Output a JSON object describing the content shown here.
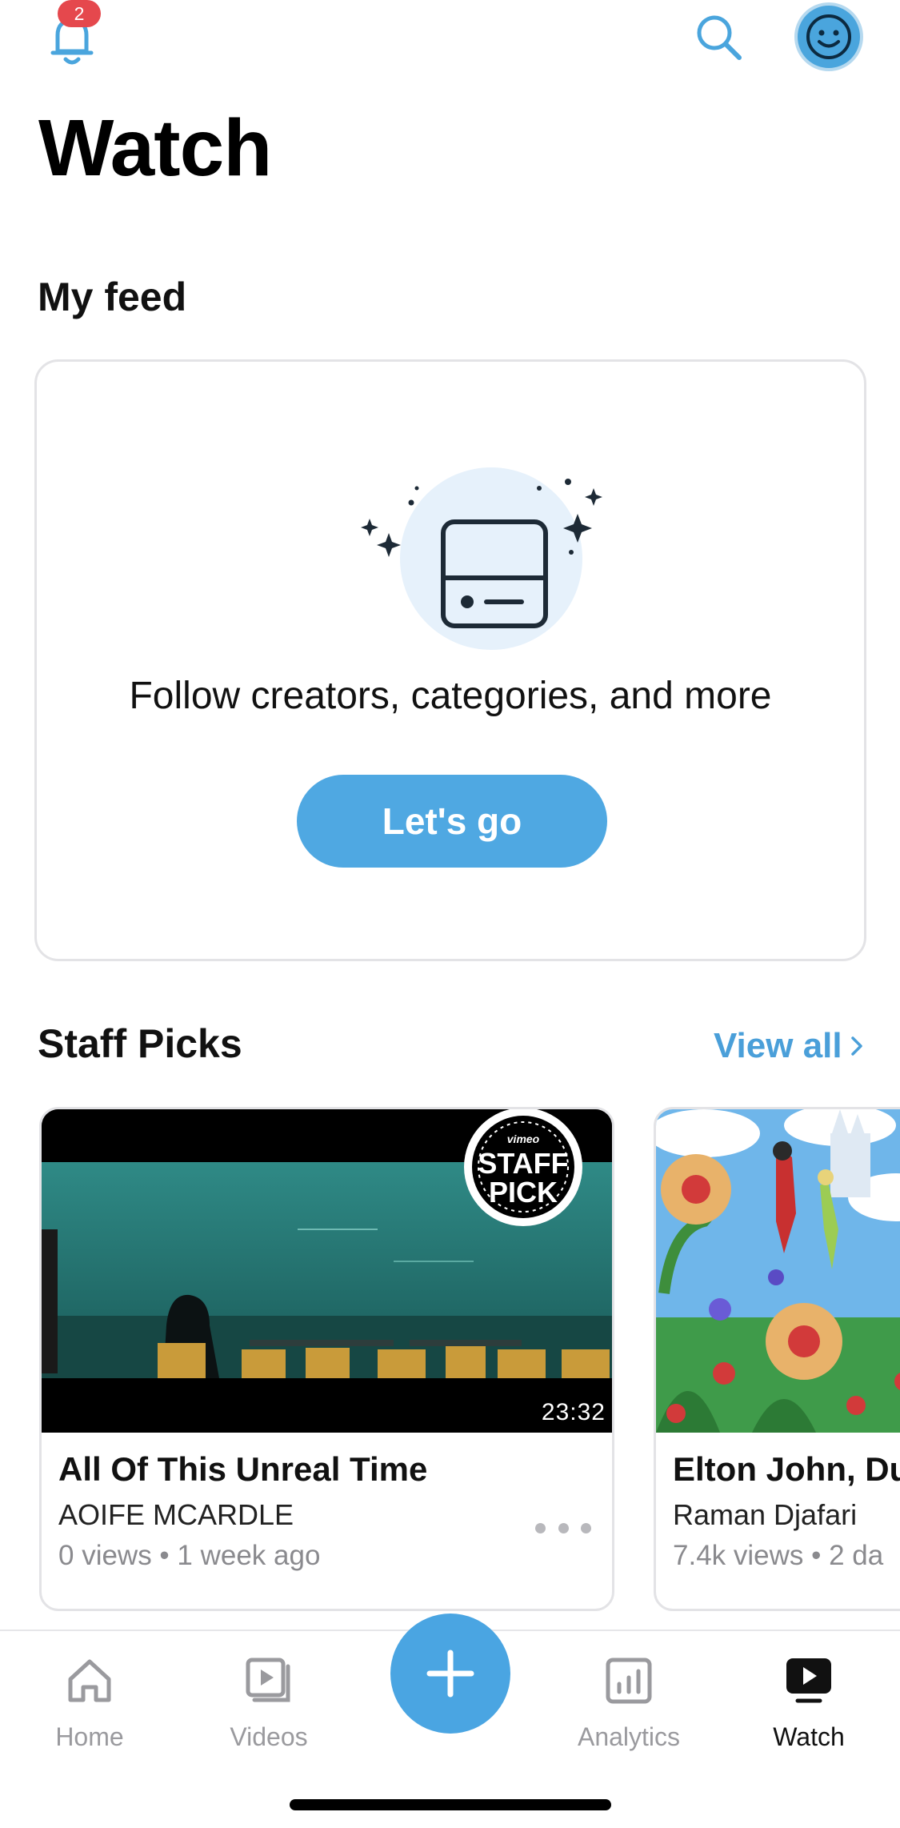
{
  "header": {
    "notification_count": "2",
    "title": "Watch"
  },
  "feed": {
    "section_title": "My feed",
    "prompt": "Follow creators, categories, and more",
    "cta_label": "Let's go"
  },
  "staff_picks": {
    "section_title": "Staff Picks",
    "view_all_label": "View all",
    "videos": [
      {
        "title": "All Of This Unreal Time",
        "author": "AOIFE MCARDLE",
        "meta": "0 views • 1 week ago",
        "duration": "23:32",
        "badge_text": [
          "vimeo",
          "STAFF",
          "PICK"
        ]
      },
      {
        "title": "Elton John, Du",
        "author": "Raman Djafari",
        "meta": "7.4k views • 2 da"
      }
    ]
  },
  "tabbar": {
    "tabs": [
      {
        "label": "Home",
        "icon": "home-icon"
      },
      {
        "label": "Videos",
        "icon": "videos-icon"
      },
      {
        "label": "Analytics",
        "icon": "analytics-icon"
      },
      {
        "label": "Watch",
        "icon": "watch-icon"
      }
    ],
    "active": "Watch",
    "fab_icon": "plus-icon"
  },
  "colors": {
    "accent": "#4fa8e2",
    "badge": "#e5484d",
    "link": "#4a9fd9",
    "muted": "#8a8a8e"
  }
}
